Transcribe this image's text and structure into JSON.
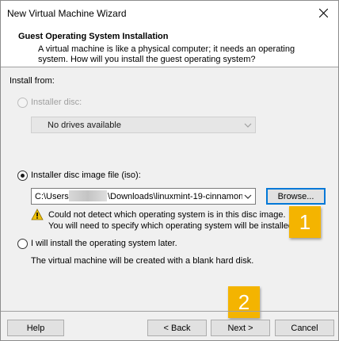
{
  "window": {
    "title": "New Virtual Machine Wizard"
  },
  "header": {
    "title": "Guest Operating System Installation",
    "description": "A virtual machine is like a physical computer; it needs an operating system. How will you install the guest operating system?"
  },
  "install_from_label": "Install from:",
  "installer_disc": {
    "label": "Installer disc:",
    "dropdown_value": "No drives available",
    "selected": false,
    "enabled": false
  },
  "iso": {
    "label": "Installer disc image file (iso):",
    "path_prefix": "C:\\Users",
    "path_suffix": "\\Downloads\\linuxmint-19-cinnamon-",
    "browse_label": "Browse...",
    "selected": true
  },
  "warning": {
    "line1": "Could not detect which operating system is in this disc image.",
    "line2": "You will need to specify which operating system will be installed."
  },
  "later": {
    "label": "I will install the operating system later.",
    "note": "The virtual machine will be created with a blank hard disk.",
    "selected": false
  },
  "footer": {
    "help_label": "Help",
    "back_label": "< Back",
    "next_label": "Next >",
    "cancel_label": "Cancel"
  },
  "callouts": {
    "badge1": "1",
    "badge2": "2"
  },
  "colors": {
    "badge": "#f4b400",
    "warning_icon": "#f2c200",
    "default_button_border": "#0078d7"
  }
}
